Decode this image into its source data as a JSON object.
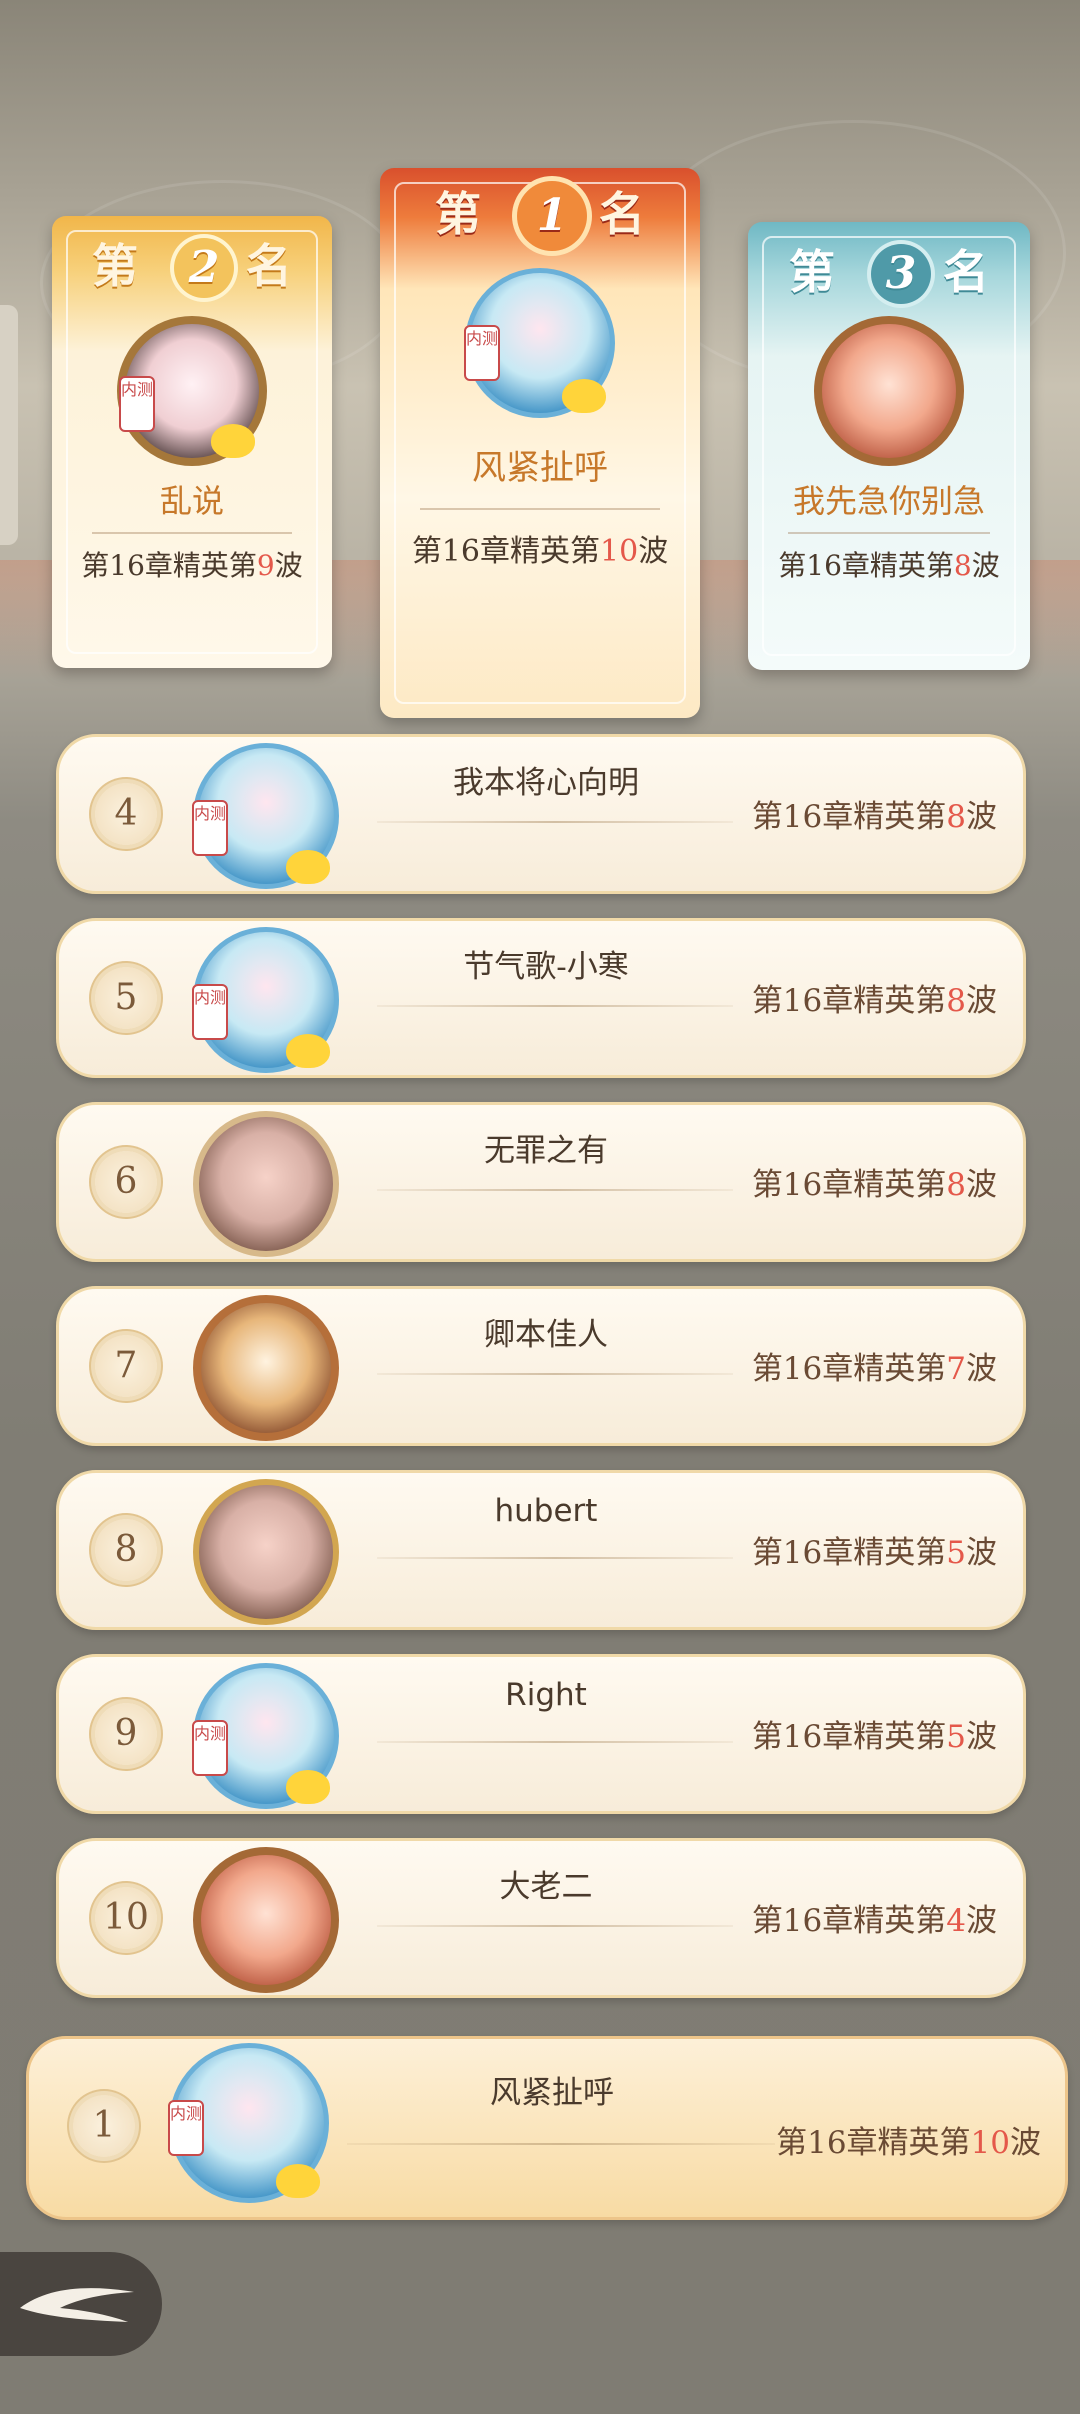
{
  "podium": [
    {
      "rank_text_a": "第",
      "rank_num": "2",
      "rank_text_b": "名",
      "name": "乱说",
      "score_prefix": "第16章精英第",
      "score_wave": "9",
      "score_suffix": "波",
      "badge": "内测"
    },
    {
      "rank_text_a": "第",
      "rank_num": "1",
      "rank_text_b": "名",
      "name": "风紧扯呼",
      "score_prefix": "第16章精英第",
      "score_wave": "10",
      "score_suffix": "波",
      "badge": "内测"
    },
    {
      "rank_text_a": "第",
      "rank_num": "3",
      "rank_text_b": "名",
      "name": "我先急你别急",
      "score_prefix": "第16章精英第",
      "score_wave": "8",
      "score_suffix": "波"
    }
  ],
  "list": [
    {
      "rank": "4",
      "name": "我本将心向明",
      "score_prefix": "第16章精英第",
      "score_wave": "8",
      "score_suffix": "波",
      "badge": "内测"
    },
    {
      "rank": "5",
      "name": "节气歌-小寒",
      "score_prefix": "第16章精英第",
      "score_wave": "8",
      "score_suffix": "波",
      "badge": "内测"
    },
    {
      "rank": "6",
      "name": "无罪之有",
      "score_prefix": "第16章精英第",
      "score_wave": "8",
      "score_suffix": "波"
    },
    {
      "rank": "7",
      "name": "卿本佳人",
      "score_prefix": "第16章精英第",
      "score_wave": "7",
      "score_suffix": "波"
    },
    {
      "rank": "8",
      "name": "hubert",
      "score_prefix": "第16章精英第",
      "score_wave": "5",
      "score_suffix": "波"
    },
    {
      "rank": "9",
      "name": "Right",
      "score_prefix": "第16章精英第",
      "score_wave": "5",
      "score_suffix": "波",
      "badge": "内测"
    },
    {
      "rank": "10",
      "name": "大老二",
      "score_prefix": "第16章精英第",
      "score_wave": "4",
      "score_suffix": "波"
    }
  ],
  "self_row": {
    "rank": "1",
    "name": "风紧扯呼",
    "score_prefix": "第16章精英第",
    "score_wave": "10",
    "score_suffix": "波",
    "badge": "内测"
  },
  "icons": {
    "back": "back-arrow-icon"
  },
  "colors": {
    "wave_highlight": "#e4584a",
    "gold": "#f3c35c",
    "orange": "#d9502d",
    "teal": "#4f9aa8"
  }
}
